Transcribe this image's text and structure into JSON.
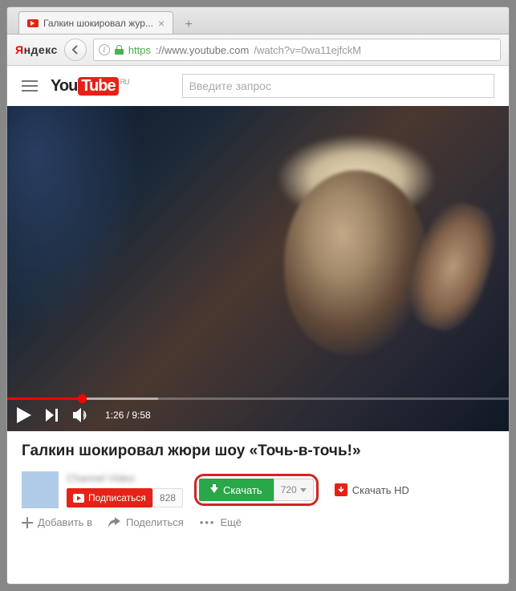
{
  "browser": {
    "tab_title": "Галкин шокировал жур...",
    "yandex_label": "Яндекс",
    "url_proto": "https",
    "url_host": "://www.youtube.com",
    "url_path": "/watch?v=0wa11ejfckM"
  },
  "youtube": {
    "logo_you": "You",
    "logo_tube": "Tube",
    "logo_region": "RU",
    "search_placeholder": "Введите запрос"
  },
  "player": {
    "current_time": "1:26",
    "duration": "9:58",
    "progress_pct": 15
  },
  "video": {
    "title": "Галкин шокировал жюри шоу «Точь-в-точь!»",
    "channel_name": "Channel Video",
    "subscribe_label": "Подписаться",
    "subscriber_count": "828"
  },
  "download": {
    "label": "Скачать",
    "quality": "720",
    "hd_label": "Скачать HD"
  },
  "actions": {
    "add": "Добавить в",
    "share": "Поделиться",
    "more": "Ещё"
  }
}
